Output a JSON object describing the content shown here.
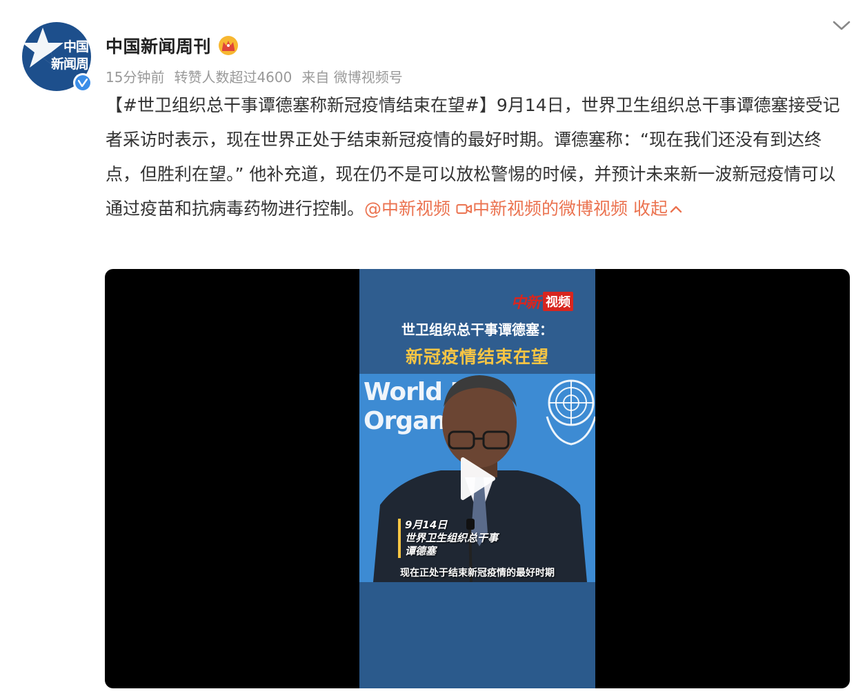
{
  "author": {
    "avatar_line1": "中国",
    "avatar_line2": "新闻周刊",
    "name": "中国新闻周刊",
    "vip_icon": "crown-icon",
    "verified_icon": "verified-v-icon"
  },
  "meta": {
    "time": "15分钟前",
    "likes": "转赞人数超过4600",
    "source": "来自 微博视频号"
  },
  "post": {
    "topic": "【#世卫组织总干事谭德塞称新冠疫情结束在望#】",
    "body": "9月14日，世界卫生组织总干事谭德塞接受记者采访时表示，现在世界正处于结束新冠疫情的最好时期。谭德塞称：“现在我们还没有到达终点，但胜利在望。” 他补充道，现在仍不是可以放松警惕的时候，并预计未来新一波新冠疫情可以通过疫苗和抗病毒药物进行控制。",
    "mention": "@中新视频",
    "video_link_icon": "video-camera-icon",
    "video_link": "中新视频的微博视频",
    "collapse": "收起"
  },
  "video": {
    "logo_script": "中新",
    "logo_tag": "视频",
    "headline_1": "世卫组织总干事谭德塞：",
    "headline_2": "新冠疫情结束在望",
    "backdrop_line1": "World H",
    "backdrop_line2": "Organi",
    "caption_date": "9月14日",
    "caption_title": "世界卫生组织总干事",
    "caption_name": "谭德塞",
    "subtitle": "现在正处于结束新冠疫情的最好时期",
    "play_icon": "play-icon"
  },
  "colors": {
    "accent": "#eb7350",
    "meta": "#999999",
    "avatar_bg": "#1d4f8c",
    "verified": "#3b8ee8",
    "headline_yellow": "#f7c544",
    "logo_red": "#d8261f"
  }
}
